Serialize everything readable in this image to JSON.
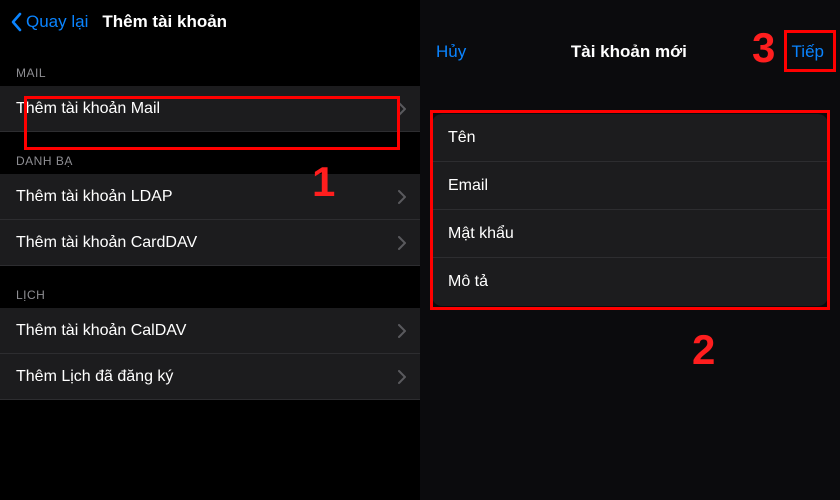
{
  "accent": "#0a84ff",
  "highlight_color": "#ff0000",
  "left": {
    "back_label": "Quay lại",
    "title": "Thêm tài khoản",
    "sections": {
      "mail": {
        "header": "MAIL",
        "rows": [
          "Thêm tài khoản Mail"
        ]
      },
      "contacts": {
        "header": "DANH BẠ",
        "rows": [
          "Thêm tài khoản LDAP",
          "Thêm tài khoản CardDAV"
        ]
      },
      "calendar": {
        "header": "LỊCH",
        "rows": [
          "Thêm tài khoản CalDAV",
          "Thêm Lịch đã đăng ký"
        ]
      }
    },
    "step_number": "1"
  },
  "right": {
    "cancel_label": "Hủy",
    "title": "Tài khoản mới",
    "next_label": "Tiếp",
    "fields": [
      "Tên",
      "Email",
      "Mật khẩu",
      "Mô tả"
    ],
    "step_form": "2",
    "step_next": "3"
  }
}
